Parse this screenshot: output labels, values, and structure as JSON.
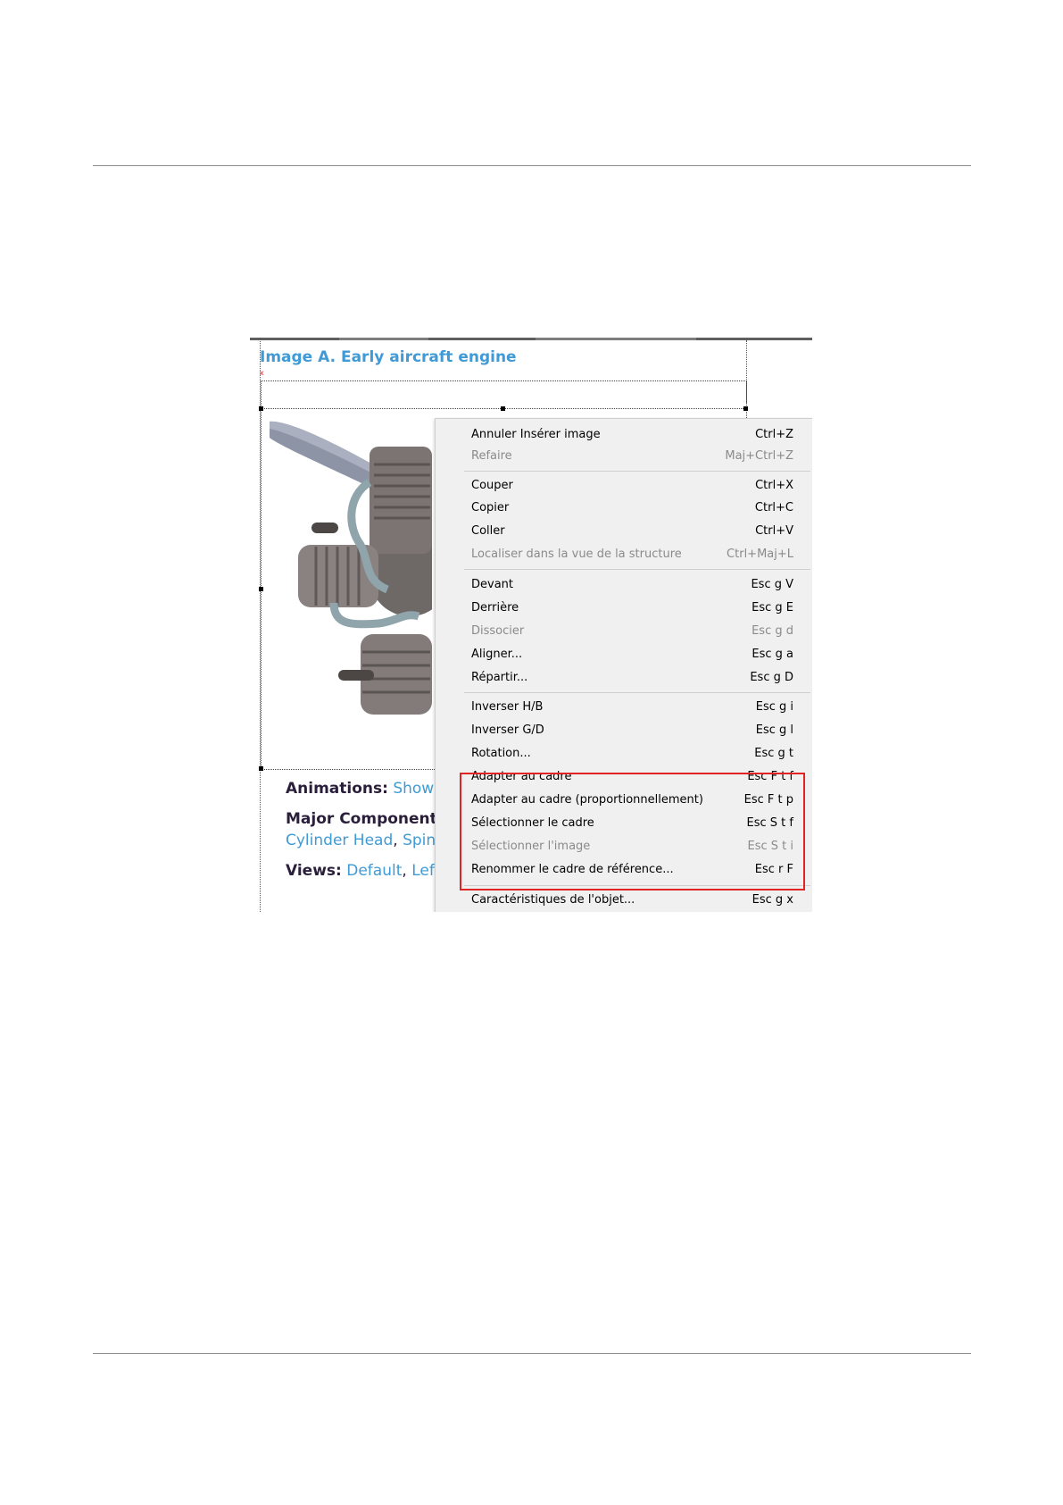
{
  "figure": {
    "title": "Image A. Early aircraft engine",
    "animations_label": "Animations:",
    "animations_link": "Show A",
    "components_label": "Major Components",
    "components_links": [
      "Cylinder Head",
      "Spinn"
    ],
    "views_label": "Views:",
    "views_links": [
      "Default",
      "Left"
    ]
  },
  "context_menu": {
    "items": [
      {
        "label": "Annuler Insérer image",
        "shortcut": "Ctrl+Z",
        "enabled": true
      },
      {
        "label": "Refaire",
        "shortcut": "Maj+Ctrl+Z",
        "enabled": false
      },
      {
        "label": "Couper",
        "shortcut": "Ctrl+X",
        "enabled": true
      },
      {
        "label": "Copier",
        "shortcut": "Ctrl+C",
        "enabled": true
      },
      {
        "label": "Coller",
        "shortcut": "Ctrl+V",
        "enabled": true
      },
      {
        "label": "Localiser dans la vue de la structure",
        "shortcut": "Ctrl+Maj+L",
        "enabled": false
      },
      {
        "label": "Devant",
        "shortcut": "Esc g V",
        "enabled": true
      },
      {
        "label": "Derrière",
        "shortcut": "Esc g E",
        "enabled": true
      },
      {
        "label": "Dissocier",
        "shortcut": "Esc g d",
        "enabled": false
      },
      {
        "label": "Aligner...",
        "shortcut": "Esc g a",
        "enabled": true
      },
      {
        "label": "Répartir...",
        "shortcut": "Esc g D",
        "enabled": true
      },
      {
        "label": "Inverser H/B",
        "shortcut": "Esc g i",
        "enabled": true
      },
      {
        "label": "Inverser G/D",
        "shortcut": "Esc g l",
        "enabled": true
      },
      {
        "label": "Rotation...",
        "shortcut": "Esc g t",
        "enabled": true
      },
      {
        "label": "Adapter au cadre",
        "shortcut": "Esc F t f",
        "enabled": true
      },
      {
        "label": "Adapter au cadre (proportionnellement)",
        "shortcut": "Esc F t p",
        "enabled": true
      },
      {
        "label": "Sélectionner le cadre",
        "shortcut": "Esc S t f",
        "enabled": true
      },
      {
        "label": "Sélectionner l'image",
        "shortcut": "Esc S t i",
        "enabled": false
      },
      {
        "label": "Renommer le cadre de référence...",
        "shortcut": "Esc r F",
        "enabled": true
      },
      {
        "label": "Caractéristiques de l'objet...",
        "shortcut": "Esc g x",
        "enabled": true
      }
    ]
  },
  "colors": {
    "link": "#3f9ad6",
    "highlight_box": "#e02424",
    "menu_bg": "#f0f0f0",
    "disabled_text": "#8a8a8a"
  }
}
